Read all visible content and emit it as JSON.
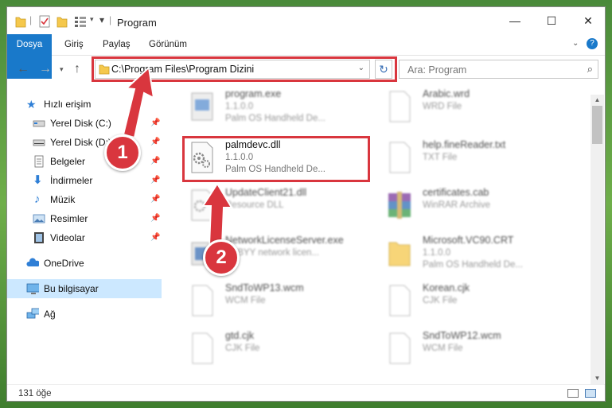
{
  "window": {
    "title": "Program"
  },
  "ribbon": {
    "tabs": [
      {
        "label": "Dosya"
      },
      {
        "label": "Giriş"
      },
      {
        "label": "Paylaş"
      },
      {
        "label": "Görünüm"
      }
    ]
  },
  "toolbar": {
    "address_path": "C:\\Program Files\\Program Dizini",
    "search_placeholder": "Ara: Program"
  },
  "navpane": {
    "items": [
      {
        "label": "Hızlı erişim",
        "icon": "star-icon"
      },
      {
        "label": "Yerel Disk (C:)",
        "icon": "drive-icon"
      },
      {
        "label": "Yerel Disk (D:)",
        "icon": "drive-icon"
      },
      {
        "label": "Belgeler",
        "icon": "documents-icon"
      },
      {
        "label": "İndirmeler",
        "icon": "download-icon"
      },
      {
        "label": "Müzik",
        "icon": "music-icon"
      },
      {
        "label": "Resimler",
        "icon": "pictures-icon"
      },
      {
        "label": "Videolar",
        "icon": "video-icon"
      },
      {
        "label": "OneDrive",
        "icon": "cloud-icon"
      },
      {
        "label": "Bu bilgisayar",
        "icon": "computer-icon"
      },
      {
        "label": "Ağ",
        "icon": "network-icon"
      }
    ]
  },
  "files": [
    {
      "name": "program.exe",
      "line1": "1.1.0.0",
      "line2": "Palm OS Handheld De...",
      "icon": "exe-icon"
    },
    {
      "name": "Arabic.wrd",
      "line1": "WRD File",
      "line2": "",
      "icon": "blank-file-icon"
    },
    {
      "name": "palmdevc.dll",
      "line1": "1.1.0.0",
      "line2": "Palm OS Handheld De...",
      "icon": "dll-icon"
    },
    {
      "name": "help.fineReader.txt",
      "line1": "TXT File",
      "line2": "",
      "icon": "blank-file-icon"
    },
    {
      "name": "UpdateClient21.dll",
      "line1": "Resource DLL",
      "line2": "",
      "icon": "dll-icon"
    },
    {
      "name": "certificates.cab",
      "line1": "WinRAR Archive",
      "line2": "",
      "icon": "archive-icon"
    },
    {
      "name": "NetworkLicenseServer.exe",
      "line1": "ABBYY network licen...",
      "line2": "",
      "icon": "exe-icon"
    },
    {
      "name": "Microsoft.VC90.CRT",
      "line1": "1.1.0.0",
      "line2": "Palm OS Handheld De...",
      "icon": "folder-icon"
    },
    {
      "name": "SndToWP13.wcm",
      "line1": "WCM File",
      "line2": "",
      "icon": "blank-file-icon"
    },
    {
      "name": "Korean.cjk",
      "line1": "CJK File",
      "line2": "",
      "icon": "blank-file-icon"
    },
    {
      "name": "gtd.cjk",
      "line1": "CJK File",
      "line2": "",
      "icon": "blank-file-icon"
    },
    {
      "name": "SndToWP12.wcm",
      "line1": "WCM File",
      "line2": "",
      "icon": "blank-file-icon"
    }
  ],
  "status": {
    "count": "131 öğe"
  },
  "annotations": {
    "step1": "1",
    "step2": "2"
  },
  "colors": {
    "accent": "#1979ca",
    "highlight": "#d9363e",
    "selection": "#cce8ff"
  }
}
